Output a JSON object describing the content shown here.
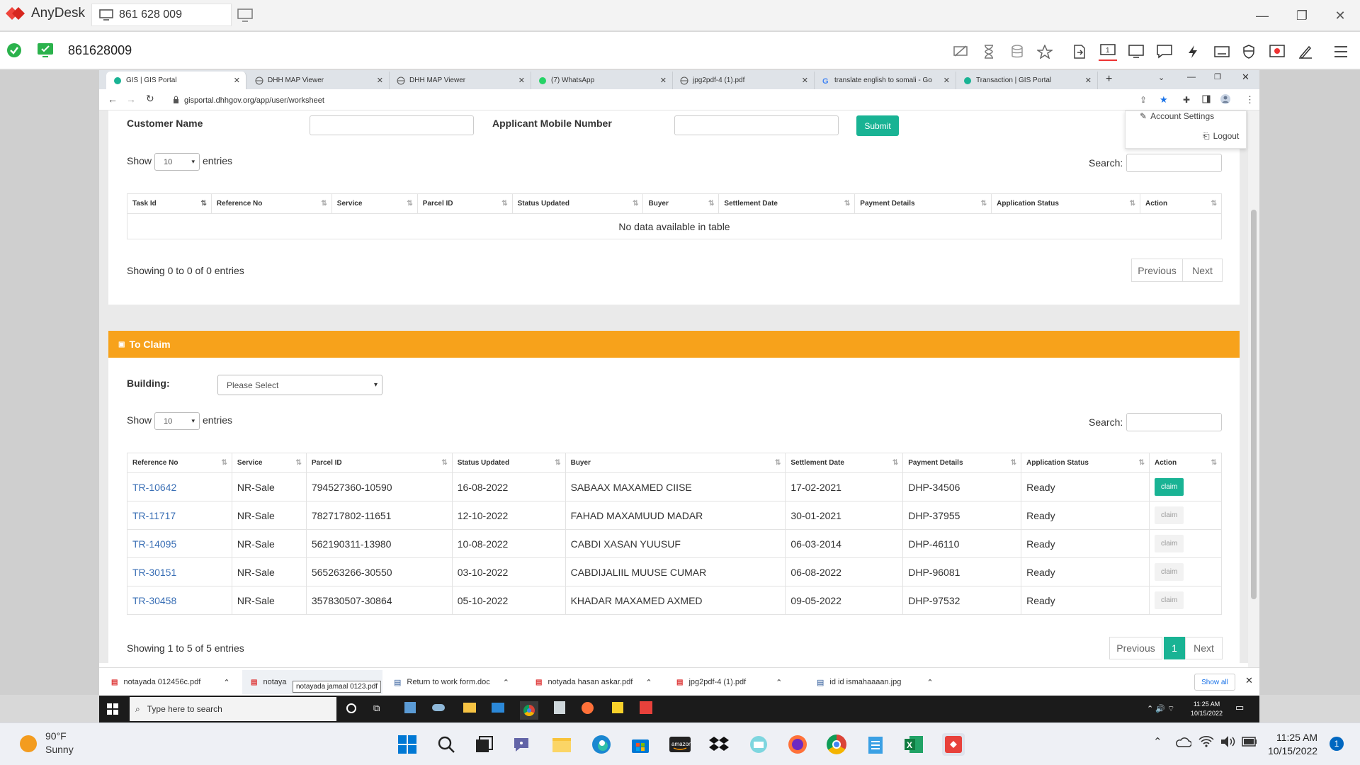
{
  "anydesk": {
    "app_name": "AnyDesk",
    "tab_label": "861 628 009",
    "remote_id": "861628009"
  },
  "browser": {
    "tabs": [
      {
        "label": "GIS | GIS Portal"
      },
      {
        "label": "DHH MAP Viewer"
      },
      {
        "label": "DHH MAP Viewer"
      },
      {
        "label": "(7) WhatsApp"
      },
      {
        "label": "jpg2pdf-4 (1).pdf"
      },
      {
        "label": "translate english to somali - Go"
      },
      {
        "label": "Transaction | GIS Portal"
      }
    ],
    "url": "gisportal.dhhgov.org/app/user/worksheet"
  },
  "user_menu": {
    "account_settings": "Account Settings",
    "logout": "Logout"
  },
  "filter": {
    "customer_name_label": "Customer Name",
    "customer_name_value": "",
    "mobile_label": "Applicant Mobile Number",
    "mobile_value": "",
    "submit_label": "Submit"
  },
  "table1": {
    "show_label": "Show",
    "entries_value": "10",
    "entries_label": "entries",
    "search_label": "Search:",
    "columns": [
      "Task Id",
      "Reference No",
      "Service",
      "Parcel ID",
      "Status Updated",
      "Buyer",
      "Settlement Date",
      "Payment Details",
      "Application Status",
      "Action"
    ],
    "empty_message": "No data available in table",
    "info": "Showing 0 to 0 of 0 entries",
    "prev_label": "Previous",
    "next_label": "Next"
  },
  "to_claim": {
    "title": "To Claim",
    "building_label": "Building:",
    "building_value": "Please Select",
    "show_label": "Show",
    "entries_value": "10",
    "entries_label": "entries",
    "search_label": "Search:",
    "columns": [
      "Reference No",
      "Service",
      "Parcel ID",
      "Status Updated",
      "Buyer",
      "Settlement Date",
      "Payment Details",
      "Application Status",
      "Action"
    ],
    "rows": [
      [
        "TR-10642",
        "NR-Sale",
        "794527360-10590",
        "16-08-2022",
        "SABAAX MAXAMED CIISE",
        "17-02-2021",
        "DHP-34506",
        "Ready",
        "claim"
      ],
      [
        "TR-11717",
        "NR-Sale",
        "782717802-11651",
        "12-10-2022",
        "FAHAD MAXAMUUD MADAR",
        "30-01-2021",
        "DHP-37955",
        "Ready",
        "claim"
      ],
      [
        "TR-14095",
        "NR-Sale",
        "562190311-13980",
        "10-08-2022",
        "CABDI XASAN YUUSUF",
        "06-03-2014",
        "DHP-46110",
        "Ready",
        "claim"
      ],
      [
        "TR-30151",
        "NR-Sale",
        "565263266-30550",
        "03-10-2022",
        "CABDIJALIIL MUUSE CUMAR",
        "06-08-2022",
        "DHP-96081",
        "Ready",
        "claim"
      ],
      [
        "TR-30458",
        "NR-Sale",
        "357830507-30864",
        "05-10-2022",
        "KHADAR MAXAMED AXMED",
        "09-05-2022",
        "DHP-97532",
        "Ready",
        "claim"
      ]
    ],
    "info": "Showing 1 to 5 of 5 entries",
    "prev_label": "Previous",
    "page": "1",
    "next_label": "Next",
    "accent_color": "#f7a21b"
  },
  "downloads": {
    "items": [
      "notayada 012456c.pdf",
      "notaya",
      "Return to work form.doc",
      "notyada hasan askar.pdf",
      "jpg2pdf-4 (1).pdf",
      "id id ismahaaaan.jpg"
    ],
    "tooltip": "notayada jamaal 0123.pdf",
    "show_all": "Show all"
  },
  "inner_taskbar": {
    "search_placeholder": "Type here to search",
    "time": "11:25 AM",
    "date": "10/15/2022"
  },
  "host_taskbar": {
    "temperature": "90°F",
    "weather": "Sunny",
    "time": "11:25 AM",
    "date": "10/15/2022",
    "notification_count": "1"
  }
}
